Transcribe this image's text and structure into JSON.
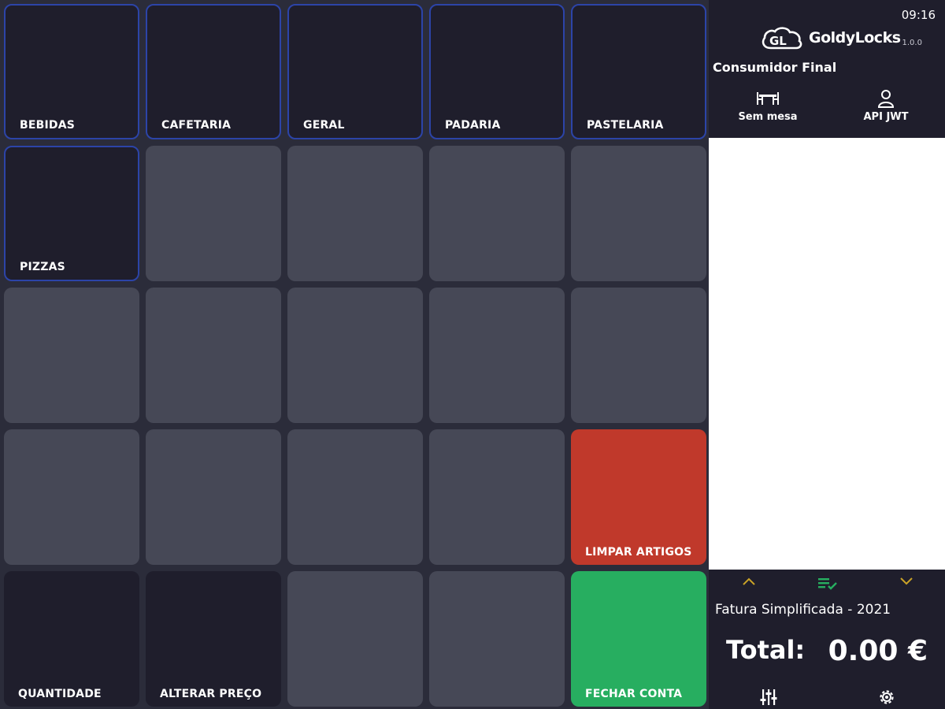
{
  "tiles": [
    {
      "label": "BEBIDAS"
    },
    {
      "label": "CAFETARIA"
    },
    {
      "label": "GERAL"
    },
    {
      "label": "PADARIA"
    },
    {
      "label": "PASTELARIA"
    },
    {
      "label": "PIZZAS"
    },
    {
      "label": "LIMPAR ARTIGOS"
    },
    {
      "label": "QUANTIDADE"
    },
    {
      "label": "ALTERAR PREÇO"
    },
    {
      "label": "FECHAR CONTA"
    }
  ],
  "panel": {
    "clock": "09:16",
    "brand": "GoldyLocks",
    "version": "1.0.0",
    "customer": "Consumidor Final",
    "table_label": "Sem mesa",
    "user_label": "API JWT",
    "document_type": "Fatura Simplificada - 2021",
    "total_label": "Total:",
    "total_value": "0.00 €"
  },
  "icons": [
    "table-icon",
    "user-icon",
    "chevron-up-icon",
    "list-check-icon",
    "chevron-down-icon",
    "sliders-icon",
    "gear-icon"
  ],
  "colors": {
    "category_border": "#2c44a8",
    "clear_button": "#c0392b",
    "close_account_button": "#27ae60",
    "list_accent": "#27ae60",
    "chevron": "#c9a227"
  }
}
